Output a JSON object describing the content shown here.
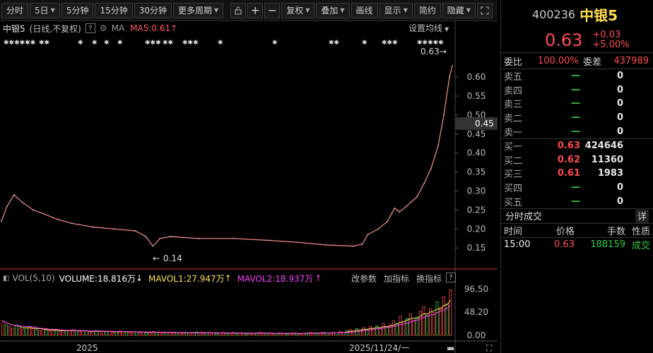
{
  "toolbar": {
    "left_buttons": [
      {
        "label": "分时",
        "dropdown": false
      },
      {
        "label": "5日",
        "dropdown": true
      },
      {
        "label": "5分钟",
        "dropdown": false
      },
      {
        "label": "15分钟",
        "dropdown": false
      },
      {
        "label": "30分钟",
        "dropdown": false
      },
      {
        "label": "更多周期",
        "dropdown": true
      }
    ],
    "right_buttons": [
      {
        "label": "复权",
        "dropdown": true
      },
      {
        "label": "叠加",
        "dropdown": true
      },
      {
        "label": "画线",
        "dropdown": false
      },
      {
        "label": "显示",
        "dropdown": true
      },
      {
        "label": "简约",
        "dropdown": false
      },
      {
        "label": "隐藏",
        "dropdown": true
      }
    ],
    "icons": [
      "lock-icon",
      "crosshair-icon",
      "minus-icon",
      "expand-icon"
    ]
  },
  "chart_head": {
    "name": "中银5",
    "mode": "(日线,不复权)",
    "help": "?",
    "ma_label": "MA",
    "ma5": "MA5:0.61",
    "settings": "设置均线"
  },
  "price_marks": {
    "last": "0.63",
    "low": "0.14",
    "cursor": "0.45"
  },
  "vol_head": {
    "label": "VOL(5,10)",
    "volume": "VOLUME:18.816万",
    "mavol1": "MAVOL1:27.947万",
    "mavol2": "MAVOL2:18.937万",
    "actions": [
      "改参数",
      "加指标",
      "换指标"
    ],
    "help": "?"
  },
  "x_axis": {
    "left": "2025",
    "right": "2025/11/24/一"
  },
  "colors": {
    "up": "#ff4d4d",
    "down": "#2ecc40",
    "price_line": "#ff8f8f",
    "mavol1": "#ffe15a",
    "mavol2": "#ff3cff"
  },
  "chart_data": [
    {
      "type": "line",
      "title": "",
      "series": [
        {
          "name": "",
          "points": [
            [
              0,
              0.22
            ],
            [
              8,
              0.26
            ],
            [
              18,
              0.29
            ],
            [
              30,
              0.27
            ],
            [
              45,
              0.25
            ],
            [
              60,
              0.24
            ],
            [
              80,
              0.225
            ],
            [
              100,
              0.215
            ],
            [
              130,
              0.205
            ],
            [
              160,
              0.2
            ],
            [
              190,
              0.195
            ],
            [
              205,
              0.18
            ],
            [
              215,
              0.155
            ],
            [
              225,
              0.175
            ],
            [
              240,
              0.18
            ],
            [
              280,
              0.175
            ],
            [
              330,
              0.175
            ],
            [
              380,
              0.17
            ],
            [
              420,
              0.165
            ],
            [
              460,
              0.158
            ],
            [
              500,
              0.155
            ],
            [
              512,
              0.16
            ],
            [
              520,
              0.185
            ],
            [
              535,
              0.2
            ],
            [
              548,
              0.22
            ],
            [
              558,
              0.255
            ],
            [
              565,
              0.245
            ],
            [
              575,
              0.26
            ],
            [
              590,
              0.285
            ],
            [
              600,
              0.32
            ],
            [
              610,
              0.36
            ],
            [
              620,
              0.42
            ],
            [
              628,
              0.5
            ],
            [
              636,
              0.6
            ],
            [
              640,
              0.63
            ]
          ]
        }
      ],
      "x_range": [
        0,
        640
      ],
      "ylim": [
        0.13,
        0.63
      ],
      "y_ticks": [
        "0.60",
        "0.55",
        "0.50",
        "0.45",
        "0.40",
        "0.35",
        "0.30",
        "0.25",
        "0.20",
        "0.15"
      ]
    },
    {
      "type": "bar",
      "title": "",
      "y_ticks": [
        "96.50",
        "48.20",
        "0.00"
      ],
      "ylim": [
        0,
        100
      ],
      "values": [
        30,
        22,
        18,
        15,
        20,
        14,
        12,
        16,
        18,
        14,
        12,
        10,
        13,
        11,
        9,
        12,
        10,
        8,
        11,
        9,
        10,
        12,
        9,
        8,
        10,
        9,
        7,
        8,
        10,
        8,
        9,
        7,
        8,
        6,
        7,
        9,
        8,
        7,
        6,
        8,
        7,
        6,
        7,
        5,
        6,
        8,
        7,
        6,
        5,
        6,
        7,
        5,
        6,
        5,
        4,
        6,
        5,
        6,
        7,
        5,
        4,
        5,
        6,
        5,
        4,
        5,
        6,
        4,
        5,
        6,
        4,
        5,
        4,
        3,
        5,
        4,
        5,
        6,
        4,
        5,
        4,
        3,
        4,
        5,
        4,
        3,
        4,
        5,
        4,
        3,
        4,
        5,
        6,
        5,
        4,
        5,
        6,
        5,
        4,
        6,
        5,
        8,
        6,
        10,
        12,
        9,
        14,
        11,
        16,
        13,
        18,
        15,
        20,
        14,
        24,
        18,
        22,
        30,
        25,
        40,
        28,
        35,
        45,
        32,
        38,
        50,
        60,
        42,
        55,
        48,
        70,
        58,
        80,
        65,
        95
      ]
    }
  ],
  "panel": {
    "code": "400236",
    "name": "中银5",
    "price": "0.63",
    "change": "+0.03",
    "change_pct": "+5.00%",
    "ratio_label": "委比",
    "ratio_value": "100.00%",
    "diff_label": "委差",
    "diff_value": "437989",
    "sells": [
      {
        "label": "卖五",
        "price": "—",
        "qty": "0"
      },
      {
        "label": "卖四",
        "price": "—",
        "qty": "0"
      },
      {
        "label": "卖三",
        "price": "—",
        "qty": "0"
      },
      {
        "label": "卖二",
        "price": "—",
        "qty": "0"
      },
      {
        "label": "卖一",
        "price": "—",
        "qty": "0"
      }
    ],
    "buys": [
      {
        "label": "买一",
        "price": "0.63",
        "qty": "424646"
      },
      {
        "label": "买二",
        "price": "0.62",
        "qty": "11360"
      },
      {
        "label": "买三",
        "price": "0.61",
        "qty": "1983"
      },
      {
        "label": "买四",
        "price": "—",
        "qty": "0"
      },
      {
        "label": "买五",
        "price": "—",
        "qty": "0"
      }
    ],
    "trades_title": "分时成交",
    "trades_detail": "详",
    "trade_cols": [
      "时间",
      "价格",
      "手数",
      "性质"
    ],
    "trades": [
      {
        "time": "15:00",
        "price": "0.63",
        "vol": "188159",
        "nature": "成交"
      }
    ]
  }
}
